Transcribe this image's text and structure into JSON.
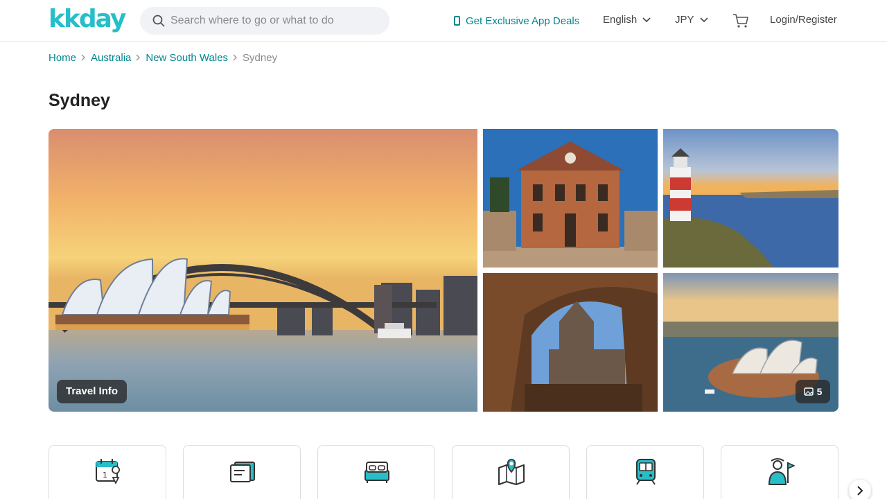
{
  "header": {
    "logo_text": "kkday",
    "search_placeholder": "Search where to go or what to do",
    "app_deals_label": "Get Exclusive App Deals",
    "language": "English",
    "currency": "JPY",
    "login_label": "Login/Register"
  },
  "breadcrumb": {
    "items": [
      "Home",
      "Australia",
      "New South Wales"
    ],
    "current": "Sydney"
  },
  "page_title": "Sydney",
  "gallery": {
    "travel_info_label": "Travel Info",
    "photo_count": "5"
  },
  "categories": {
    "icons": [
      "calendar-location-icon",
      "ticket-icon",
      "bed-icon",
      "map-pin-icon",
      "train-icon",
      "tour-guide-icon"
    ]
  },
  "colors": {
    "brand": "#26bec9",
    "link": "#00868f"
  }
}
